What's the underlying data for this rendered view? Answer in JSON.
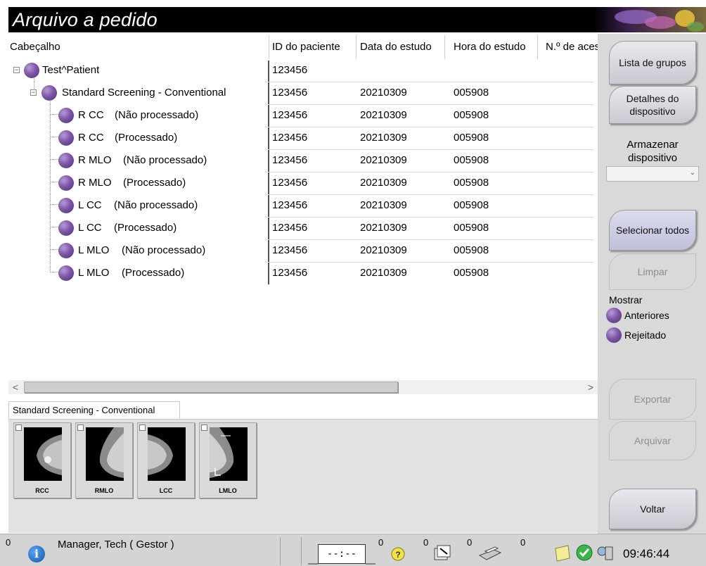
{
  "window": {
    "title": "Arquivo a pedido"
  },
  "table": {
    "headers": [
      "Cabeçalho",
      "ID do paciente",
      "Data do estudo",
      "Hora do estudo",
      "N.º de acesso"
    ],
    "rows": [
      {
        "name": "Test^Patient",
        "status": "",
        "patient_id": "123456",
        "date": "",
        "time": ""
      },
      {
        "name": "Standard Screening - Conventional",
        "status": "",
        "patient_id": "123456",
        "date": "20210309",
        "time": "005908"
      },
      {
        "name": "R CC",
        "status": "(Não processado)",
        "patient_id": "123456",
        "date": "20210309",
        "time": "005908"
      },
      {
        "name": "R CC",
        "status": "(Processado)",
        "patient_id": "123456",
        "date": "20210309",
        "time": "005908"
      },
      {
        "name": "R MLO",
        "status": "(Não processado)",
        "patient_id": "123456",
        "date": "20210309",
        "time": "005908"
      },
      {
        "name": "R MLO",
        "status": "(Processado)",
        "patient_id": "123456",
        "date": "20210309",
        "time": "005908"
      },
      {
        "name": "L CC",
        "status": "(Não processado)",
        "patient_id": "123456",
        "date": "20210309",
        "time": "005908"
      },
      {
        "name": "L CC",
        "status": "(Processado)",
        "patient_id": "123456",
        "date": "20210309",
        "time": "005908"
      },
      {
        "name": "L MLO",
        "status": "(Não processado)",
        "patient_id": "123456",
        "date": "20210309",
        "time": "005908"
      },
      {
        "name": "L MLO",
        "status": "(Processado)",
        "patient_id": "123456",
        "date": "20210309",
        "time": "005908"
      }
    ]
  },
  "scrollbar": {
    "left_arrow": "<",
    "right_arrow": ">"
  },
  "thumbnails": {
    "tab_label": "Standard Screening - Conventional",
    "items": [
      {
        "label": "RCC"
      },
      {
        "label": "RMLO"
      },
      {
        "label": "LCC"
      },
      {
        "label": "LMLO"
      }
    ]
  },
  "sidebar": {
    "group_list_button": "Lista de grupos",
    "device_details_button": "Detalhes do dispositivo",
    "storage_device_label": "Armazenar dispositivo",
    "storage_device_value": "",
    "select_all_button": "Selecionar todos",
    "clear_button": "Limpar",
    "show_label": "Mostrar",
    "show_options": [
      "Anteriores",
      "Rejeitado"
    ],
    "export_button": "Exportar",
    "archive_button": "Arquivar",
    "back_button": "Voltar"
  },
  "statusbar": {
    "alert_count": "0",
    "user": "Manager, Tech ( Gestor )",
    "clock_display": "--:--",
    "counts": [
      "0",
      "0",
      "0",
      "0"
    ],
    "time": "09:46:44"
  },
  "colors": {
    "accent_purple": "#7e57a8",
    "titlebar": "#000000",
    "sidebar": "#d9d9d9"
  }
}
